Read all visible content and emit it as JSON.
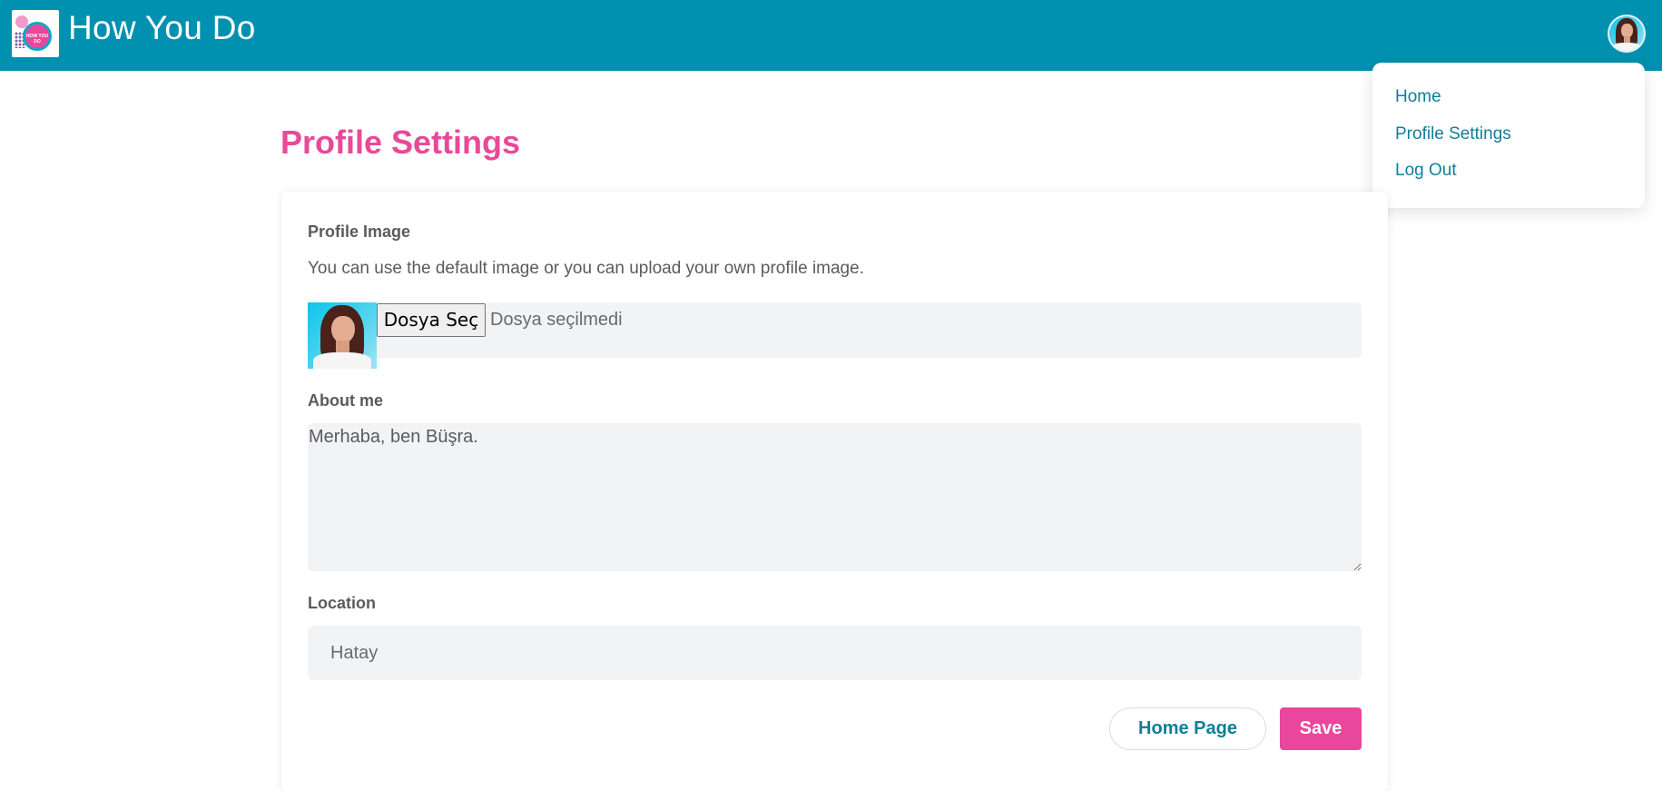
{
  "header": {
    "brand_title": "How You Do",
    "logo_text": "HOW YOU DO",
    "avatar_alt": "user avatar"
  },
  "dropdown": {
    "items": [
      {
        "label": "Home"
      },
      {
        "label": "Profile Settings"
      },
      {
        "label": "Log Out"
      }
    ]
  },
  "page": {
    "title": "Profile Settings"
  },
  "form": {
    "profile_image": {
      "label": "Profile Image",
      "helper": "You can use the default image or you can upload your own profile image.",
      "file_button_label": "Dosya Seç",
      "file_status": "Dosya seçilmedi"
    },
    "about": {
      "label": "About me",
      "value": "Merhaba, ben Büşra."
    },
    "location": {
      "label": "Location",
      "value": "Hatay"
    },
    "buttons": {
      "home_page": "Home Page",
      "save": "Save"
    }
  },
  "colors": {
    "navbar": "#0091b0",
    "accent_pink": "#e84a98",
    "link_teal": "#0f7f98",
    "field_bg": "#f2f3f5"
  }
}
